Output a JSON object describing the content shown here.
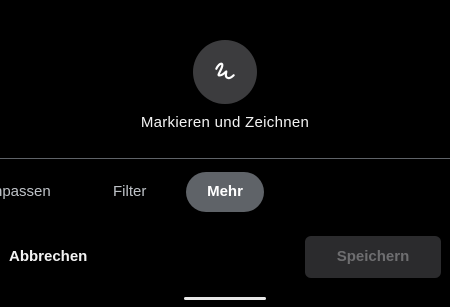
{
  "tool": {
    "icon": "squiggle-draw-icon",
    "label": "Markieren und Zeichnen"
  },
  "tabs": [
    {
      "label": "Anpassen",
      "visible_text": "npassen",
      "selected": false
    },
    {
      "label": "Filter",
      "selected": false
    },
    {
      "label": "Mehr",
      "selected": true
    }
  ],
  "actions": {
    "cancel_label": "Abbrechen",
    "save_label": "Speichern",
    "save_enabled": false
  },
  "colors": {
    "background": "#000000",
    "tool_circle": "#3c3c3e",
    "selected_tab": "#5f6368",
    "save_button_disabled": "#2b2b2d"
  }
}
